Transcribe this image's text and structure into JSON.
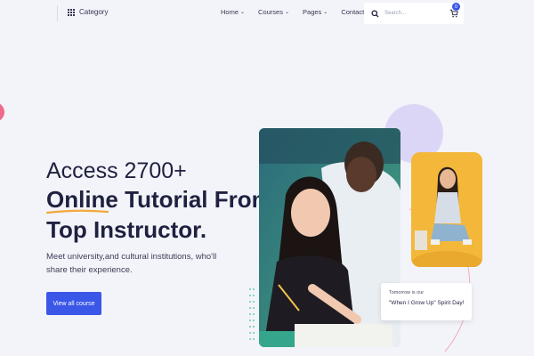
{
  "header": {
    "category_label": "Category",
    "nav": [
      {
        "label": "Home",
        "chevron": true
      },
      {
        "label": "Courses",
        "chevron": true
      },
      {
        "label": "Pages",
        "chevron": true
      },
      {
        "label": "Contact",
        "chevron": false
      }
    ],
    "search_placeholder": "Search...",
    "cart_count": "0"
  },
  "hero": {
    "line1": "Access 2700+",
    "line2": "Online Tutorial From",
    "line3": "Top Instructor.",
    "subtitle": "Meet university,and cultural institutions, who'll share their experience.",
    "cta_label": "View all course"
  },
  "quote_card": {
    "small": "Tomorrow is our",
    "big": "\"When I Grow Up\" Spirit Day!"
  },
  "colors": {
    "accent": "#3a57e8",
    "underline": "#f2a93b",
    "background": "#f3f4f9",
    "lavender": "#dcd6f6",
    "pink": "#f06a8c",
    "yellow_card": "#f3b83a"
  },
  "icons": {
    "category": "grid-icon",
    "search": "search-icon",
    "cart": "cart-icon"
  }
}
